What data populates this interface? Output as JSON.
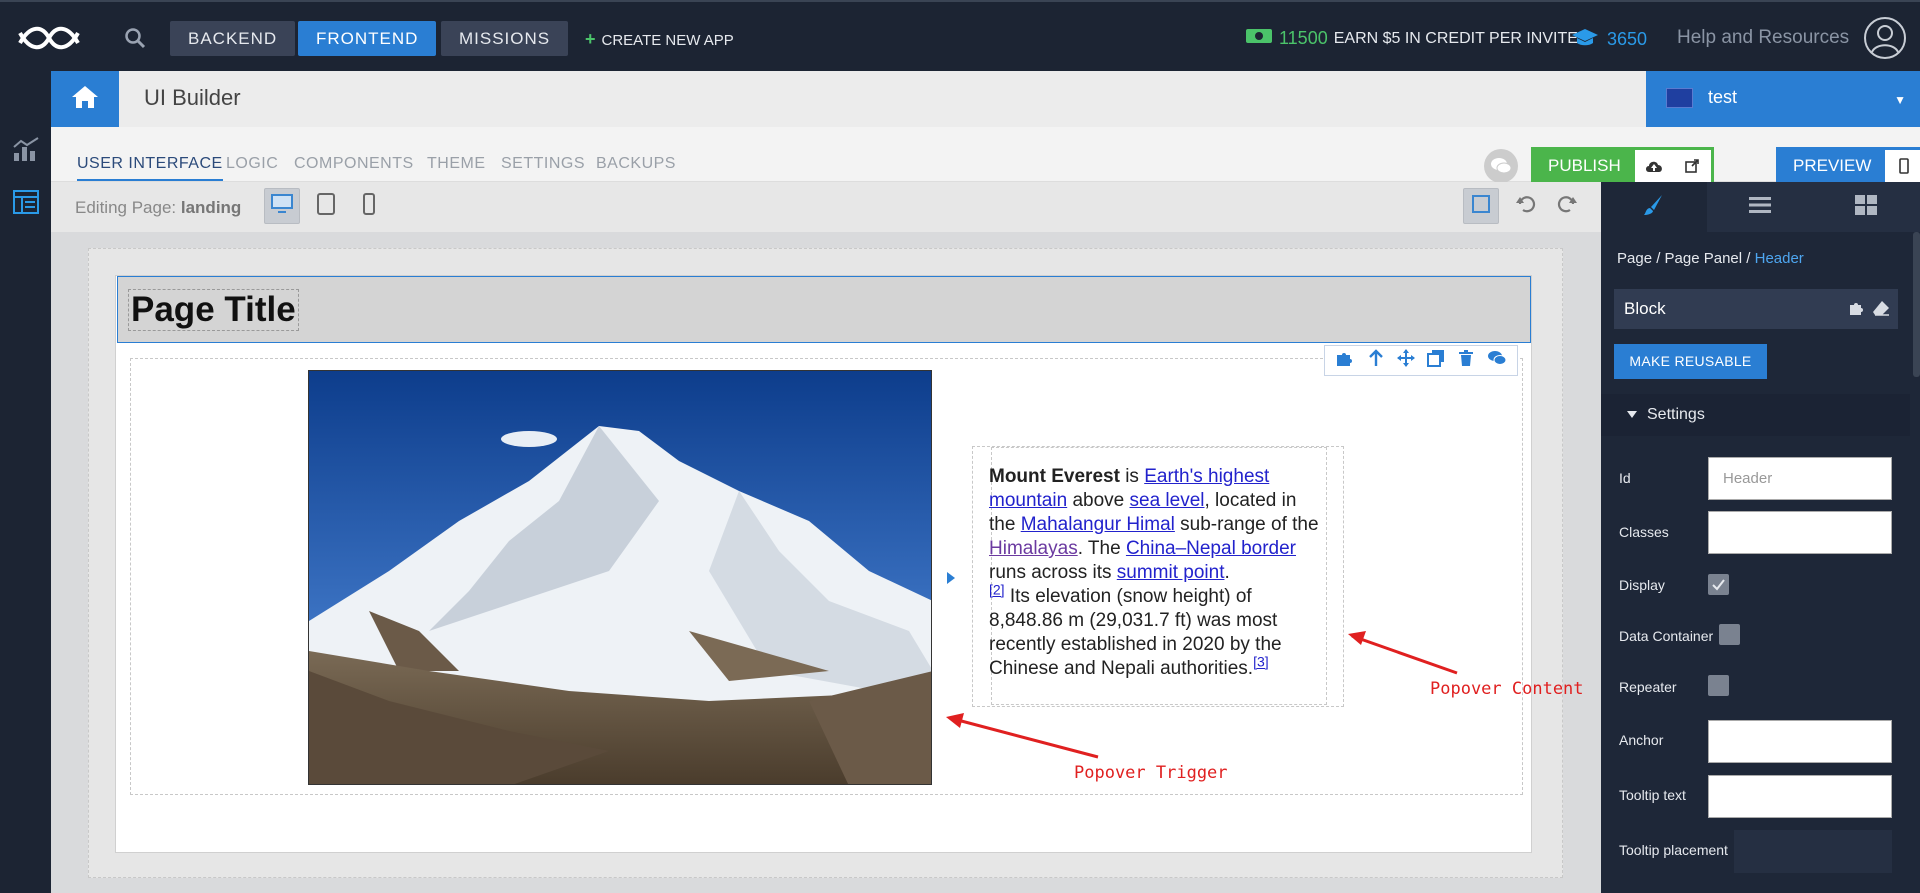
{
  "topbar": {
    "nav": [
      "BACKEND",
      "FRONTEND",
      "MISSIONS"
    ],
    "create_label": "CREATE NEW APP",
    "credits_count": "11500",
    "credits_text": "EARN $5 IN CREDIT PER INVITE",
    "points": "3650",
    "help": "Help and Resources"
  },
  "header": {
    "title": "UI Builder",
    "environment": "test"
  },
  "tabs": [
    "USER INTERFACE",
    "LOGIC",
    "COMPONENTS",
    "THEME",
    "SETTINGS",
    "BACKUPS"
  ],
  "actions": {
    "publish": "PUBLISH",
    "preview": "PREVIEW"
  },
  "editing": {
    "label": "Editing Page:",
    "page": "landing"
  },
  "canvas": {
    "page_title": "Page Title",
    "popover": {
      "p1_bold": "Mount Everest",
      "p1_a": " is ",
      "link1": "Earth's highest mountain",
      "p1_b": " above ",
      "link2": "sea level",
      "p1_c": ", located in the ",
      "link3": "Mahalangur Himal",
      "p1_d": " sub-range of the ",
      "link4": "Himalayas",
      "p1_e": ". The ",
      "link5": "China–Nepal border",
      "p1_f": " runs across its ",
      "link6": "summit point",
      "p1_g": ".",
      "ref2": "[2]",
      "p2": " Its elevation (snow height) of 8,848.86 m (29,031.7 ft) was most recently established in 2020 by the Chinese and Nepali authorities.",
      "ref3": "[3]"
    },
    "annotation_content": "Popover Content",
    "annotation_trigger": "Popover Trigger"
  },
  "panel": {
    "crumb_a": "Page / Page Panel / ",
    "crumb_current": "Header",
    "block_label": "Block",
    "make_reusable": "MAKE REUSABLE",
    "settings_label": "Settings",
    "props": {
      "id_label": "Id",
      "id_placeholder": "Header",
      "classes_label": "Classes",
      "display_label": "Display",
      "data_container_label": "Data Container",
      "repeater_label": "Repeater",
      "anchor_label": "Anchor",
      "tooltip_text_label": "Tooltip text",
      "tooltip_placement_label": "Tooltip placement"
    }
  },
  "colors": {
    "accent": "#2a7ed3",
    "publish": "#4bb54b",
    "topbar": "#1c2433",
    "annotation": "#e02020"
  }
}
